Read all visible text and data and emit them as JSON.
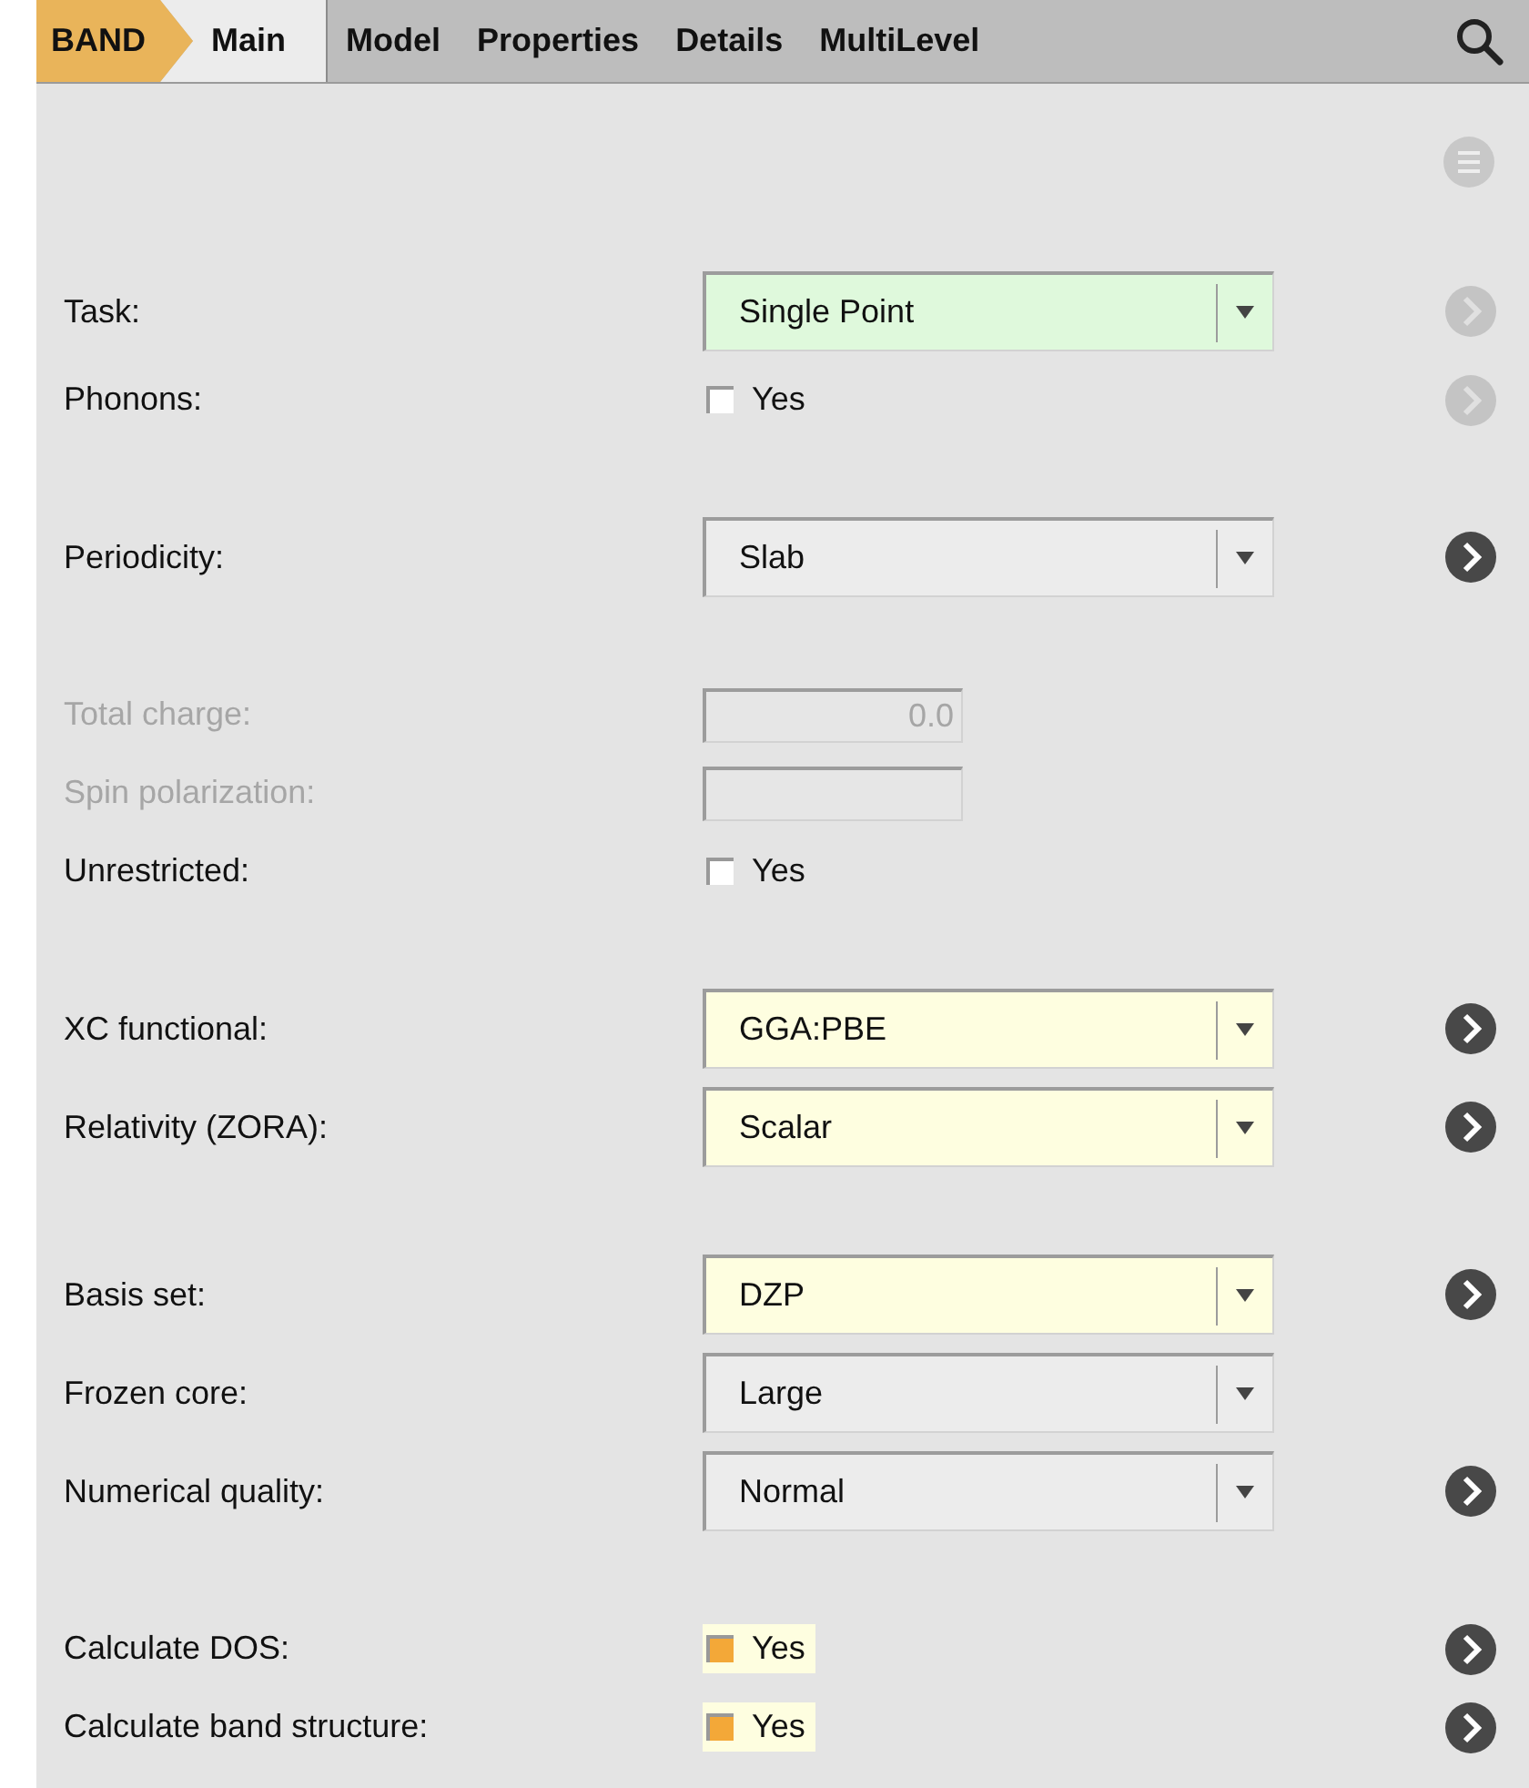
{
  "app_badge": {
    "label": "BAND"
  },
  "tabs": [
    {
      "label": "Main",
      "selected": true
    },
    {
      "label": "Model",
      "selected": false
    },
    {
      "label": "Properties",
      "selected": false
    },
    {
      "label": "Details",
      "selected": false
    },
    {
      "label": "MultiLevel",
      "selected": false
    }
  ],
  "sections": [
    {
      "rows": [
        {
          "kind": "dropdown",
          "label": "Task:",
          "value": "Single Point",
          "color": "#dff9dc",
          "details_button": true,
          "details_disabled": true
        },
        {
          "kind": "checkbox",
          "label": "Phonons:",
          "value": "Yes",
          "checked": false,
          "details_button": true,
          "details_disabled": true
        }
      ]
    },
    {
      "rows": [
        {
          "kind": "dropdown",
          "label": "Periodicity:",
          "value": "Slab",
          "details_button": true,
          "details_disabled": false
        }
      ]
    },
    {
      "rows": [
        {
          "kind": "textfield",
          "label": "Total charge:",
          "value": "0.0",
          "disabled": true
        },
        {
          "kind": "textfield",
          "label": "Spin polarization:",
          "disabled": true
        },
        {
          "kind": "checkbox",
          "label": "Unrestricted:",
          "value": "Yes",
          "checked": false
        }
      ]
    },
    {
      "rows": [
        {
          "kind": "dropdown",
          "label": "XC functional:",
          "value": "GGA:PBE",
          "color": "#fefee0",
          "details_button": true,
          "details_disabled": false
        },
        {
          "kind": "dropdown",
          "label": "Relativity (ZORA):",
          "value": "Scalar",
          "color": "#fefee0",
          "details_button": true,
          "details_disabled": false
        }
      ]
    },
    {
      "rows": [
        {
          "kind": "dropdown",
          "label": "Basis set:",
          "value": "DZP",
          "color": "#fefee0",
          "details_button": true,
          "details_disabled": false
        },
        {
          "kind": "dropdown",
          "label": "Frozen core:",
          "value": "Large"
        },
        {
          "kind": "dropdown",
          "label": "Numerical quality:",
          "value": "Normal",
          "details_button": true,
          "details_disabled": false
        }
      ]
    },
    {
      "rows": [
        {
          "kind": "checkbox",
          "label": "Calculate DOS:",
          "value": "Yes",
          "checked": true,
          "details_button": true,
          "details_disabled": false
        },
        {
          "kind": "checkbox",
          "label": "Calculate band structure:",
          "value": "Yes",
          "checked": true,
          "details_button": true,
          "details_disabled": false
        }
      ]
    }
  ]
}
